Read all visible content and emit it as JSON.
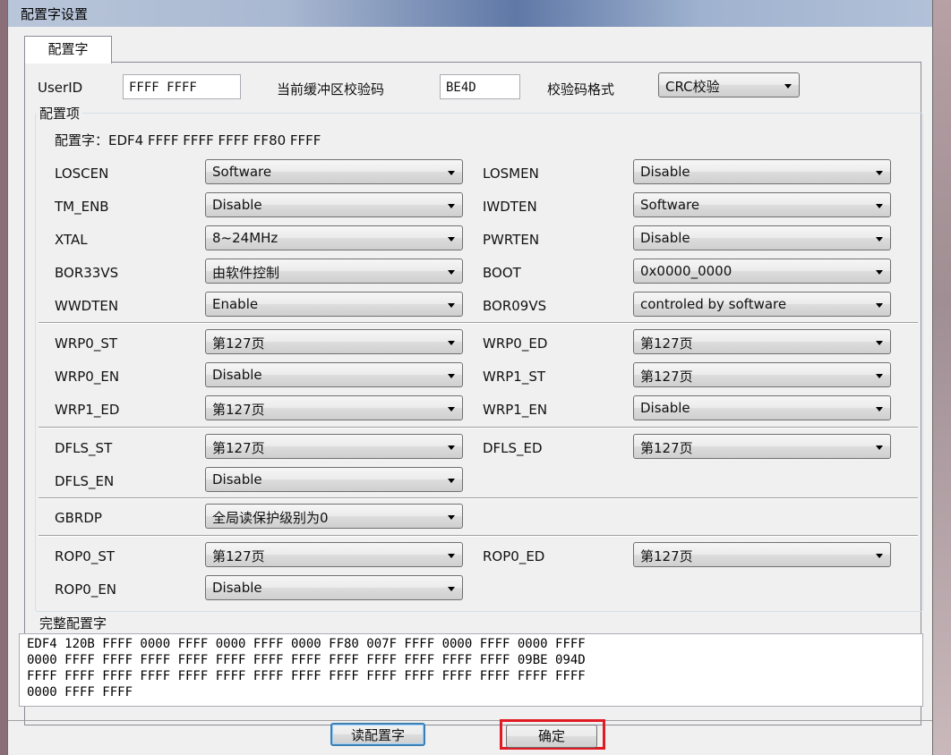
{
  "window": {
    "title": "配置字设置"
  },
  "tab": {
    "label": "配置字"
  },
  "top": {
    "userid_label": "UserID",
    "userid_value": "FFFF FFFF",
    "checksum_label": "当前缓冲区校验码",
    "checksum_value": "BE4D",
    "format_label": "校验码格式",
    "format_value": "CRC校验"
  },
  "config_group": {
    "legend": "配置项",
    "config_word": "配置字：EDF4 FFFF FFFF FFFF FF80 FFFF"
  },
  "rows": {
    "losc_en": {
      "label": "LOSCEN",
      "value": "Software"
    },
    "losm_en": {
      "label": "LOSMEN",
      "value": "Disable"
    },
    "tm_enb": {
      "label": "TM_ENB",
      "value": "Disable"
    },
    "iwdt_en": {
      "label": "IWDTEN",
      "value": "Software"
    },
    "xtal": {
      "label": "XTAL",
      "value": "8~24MHz"
    },
    "pwrt_en": {
      "label": "PWRTEN",
      "value": "Disable"
    },
    "bor33vs": {
      "label": "BOR33VS",
      "value": "由软件控制"
    },
    "boot": {
      "label": "BOOT",
      "value": "0x0000_0000"
    },
    "wwdt_en": {
      "label": "WWDTEN",
      "value": "Enable"
    },
    "bor09vs": {
      "label": "BOR09VS",
      "value": "controled by software"
    },
    "wrp0_st": {
      "label": "WRP0_ST",
      "value": "第127页"
    },
    "wrp0_ed": {
      "label": "WRP0_ED",
      "value": "第127页"
    },
    "wrp0_en": {
      "label": "WRP0_EN",
      "value": "Disable"
    },
    "wrp1_st": {
      "label": "WRP1_ST",
      "value": "第127页"
    },
    "wrp1_ed": {
      "label": "WRP1_ED",
      "value": "第127页"
    },
    "wrp1_en": {
      "label": "WRP1_EN",
      "value": "Disable"
    },
    "dfls_st": {
      "label": "DFLS_ST",
      "value": "第127页"
    },
    "dfls_ed": {
      "label": "DFLS_ED",
      "value": "第127页"
    },
    "dfls_en": {
      "label": "DFLS_EN",
      "value": "Disable"
    },
    "gbrdp": {
      "label": "GBRDP",
      "value": "全局读保护级别为0"
    },
    "rop0_st": {
      "label": "ROP0_ST",
      "value": "第127页"
    },
    "rop0_ed": {
      "label": "ROP0_ED",
      "value": "第127页"
    },
    "rop0_en": {
      "label": "ROP0_EN",
      "value": "Disable"
    }
  },
  "full_group": {
    "legend": "完整配置字",
    "lines": [
      "EDF4 120B FFFF 0000 FFFF 0000 FFFF 0000 FF80 007F FFFF 0000 FFFF 0000 FFFF",
      "0000 FFFF FFFF FFFF FFFF FFFF FFFF FFFF FFFF FFFF FFFF FFFF FFFF 09BE 094D",
      "FFFF FFFF FFFF FFFF FFFF FFFF FFFF FFFF FFFF FFFF FFFF FFFF FFFF FFFF FFFF",
      "0000 FFFF FFFF"
    ]
  },
  "buttons": {
    "read_label": "读配置字",
    "ok_label": "确定"
  },
  "colors": {
    "highlight": "#e01b24",
    "focus": "#3c7fb1"
  }
}
